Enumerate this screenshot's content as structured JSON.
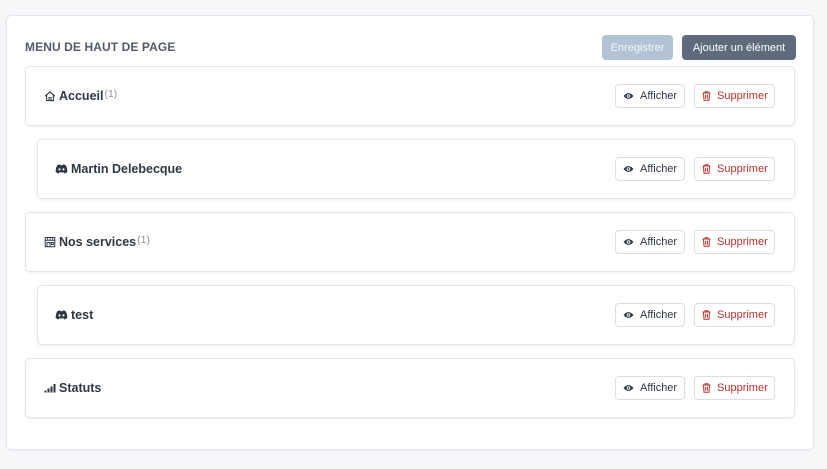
{
  "menu": {
    "title": "MENU DE HAUT DE PAGE",
    "save_label": "Enregistrer",
    "add_label": "Ajouter un élément"
  },
  "actions": {
    "show_label": "Afficher",
    "delete_label": "Supprimer"
  },
  "items": [
    {
      "label": "Accueil",
      "count": "(1)",
      "icon": "home-icon",
      "level": 0
    },
    {
      "label": "Martin Delebecque",
      "count": "",
      "icon": "discord-icon",
      "level": 1
    },
    {
      "label": "Nos services",
      "count": "(1)",
      "icon": "shop-icon",
      "level": 0
    },
    {
      "label": "test",
      "count": "",
      "icon": "discord-icon",
      "level": 1
    },
    {
      "label": "Statuts",
      "count": "",
      "icon": "signal-bars-icon",
      "level": 0
    }
  ],
  "colors": {
    "save_button": "#b3c3d6",
    "add_button": "#5f6b7c",
    "delete_text": "#b4312c"
  }
}
